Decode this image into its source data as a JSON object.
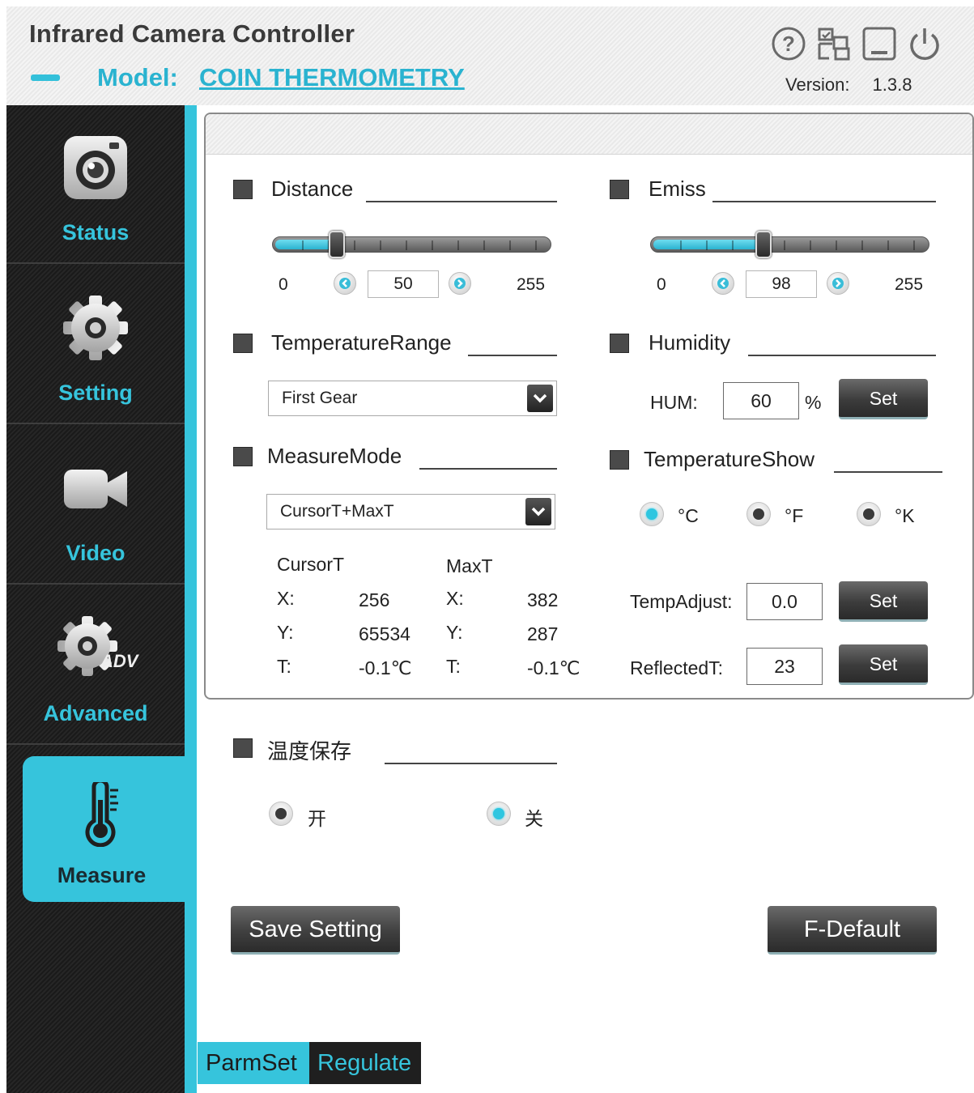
{
  "header": {
    "title": "Infrared Camera Controller",
    "model_label": "Model:",
    "model_value": "COIN THERMOMETRY",
    "version_label": "Version:",
    "version_value": "1.3.8",
    "icons": [
      "help-icon",
      "device-settings-icon",
      "minimize-icon",
      "power-icon"
    ]
  },
  "sidebar": {
    "items": [
      {
        "label": "Status",
        "icon": "camera-icon"
      },
      {
        "label": "Setting",
        "icon": "gear-icon"
      },
      {
        "label": "Video",
        "icon": "video-camera-icon"
      },
      {
        "label": "Advanced",
        "icon": "advanced-gear-icon",
        "badge": "ADV"
      },
      {
        "label": "Measure",
        "icon": "thermometer-icon",
        "active": true
      }
    ]
  },
  "distance": {
    "title": "Distance",
    "min": "0",
    "max": "255",
    "value": "50",
    "level": 50
  },
  "emiss": {
    "title": "Emiss",
    "min": "0",
    "max": "255",
    "value": "98",
    "level": 98
  },
  "temperature_range": {
    "title": "TemperatureRange",
    "selected": "First Gear"
  },
  "humidity": {
    "title": "Humidity",
    "label": "HUM:",
    "value": "60",
    "unit": "%",
    "set_label": "Set"
  },
  "measure_mode": {
    "title": "MeasureMode",
    "selected": "CursorT+MaxT"
  },
  "temperature_show": {
    "title": "TemperatureShow",
    "options": [
      {
        "label": "°C",
        "selected": true
      },
      {
        "label": "°F",
        "selected": false
      },
      {
        "label": "°K",
        "selected": false
      }
    ]
  },
  "readouts": {
    "cursor_title": "CursorT",
    "max_title": "MaxT",
    "x_label": "X:",
    "y_label": "Y:",
    "t_label": "T:",
    "cursor": {
      "x": "256",
      "y": "65534",
      "t": "-0.1℃"
    },
    "max": {
      "x": "382",
      "y": "287",
      "t": "-0.1℃"
    }
  },
  "temp_adjust": {
    "label": "TempAdjust:",
    "value": "0.0",
    "set_label": "Set"
  },
  "reflected_t": {
    "label": "ReflectedT:",
    "value": "23",
    "set_label": "Set"
  },
  "temp_save": {
    "title": "温度保存",
    "options": [
      {
        "label": "开",
        "selected": false
      },
      {
        "label": "关",
        "selected": true
      }
    ]
  },
  "actions": {
    "save_label": "Save Setting",
    "default_label": "F-Default"
  },
  "tabs": [
    {
      "label": "ParmSet",
      "active": true
    },
    {
      "label": "Regulate",
      "active": false
    }
  ],
  "colors": {
    "accent": "#36c4dc",
    "sidebar": "#1f1f1f",
    "button": "#3c3c3c"
  }
}
